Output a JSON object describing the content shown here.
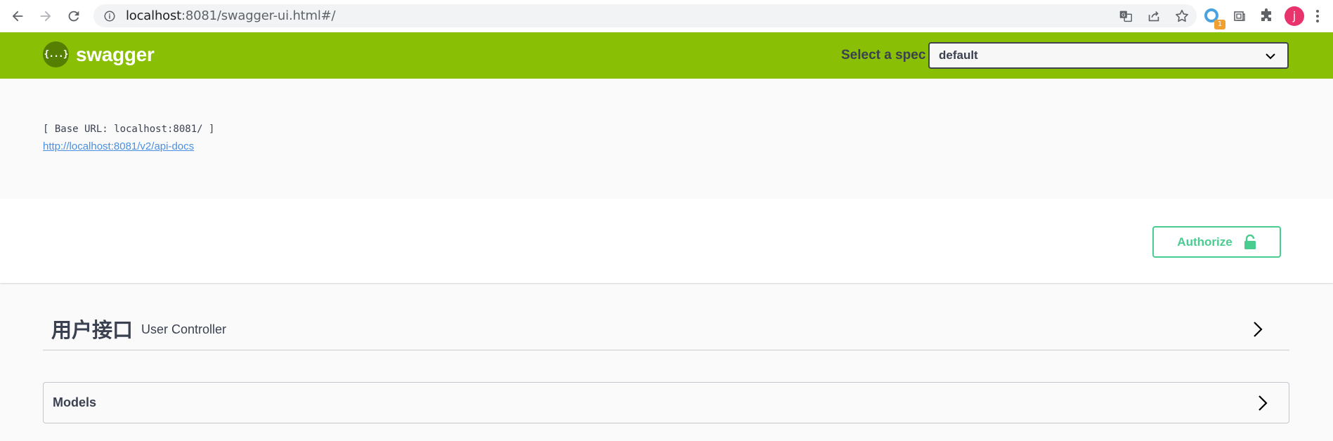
{
  "browser": {
    "url_host": "localhost",
    "url_path": ":8081/swagger-ui.html#/",
    "ext_badge": "1",
    "avatar_letter": "j",
    "icons": [
      "back-icon",
      "forward-icon",
      "reload-icon",
      "info-icon",
      "translate-icon",
      "share-icon",
      "star-icon",
      "extension-icon",
      "puzzle-icon",
      "kebab-menu-icon"
    ]
  },
  "topbar": {
    "logo_symbol": "{...}",
    "logo_text": "swagger",
    "spec_label": "Select a spec",
    "spec_selected": "default",
    "bg_color": "#89bf04"
  },
  "info": {
    "base_url": "[ Base URL: localhost:8081/ ]",
    "api_docs_link": "http://localhost:8081/v2/api-docs"
  },
  "scheme": {
    "authorize_label": "Authorize",
    "accent_color": "#49cc90"
  },
  "operations": {
    "tag_name": "用户接口",
    "tag_description": "User Controller"
  },
  "models": {
    "title": "Models"
  }
}
